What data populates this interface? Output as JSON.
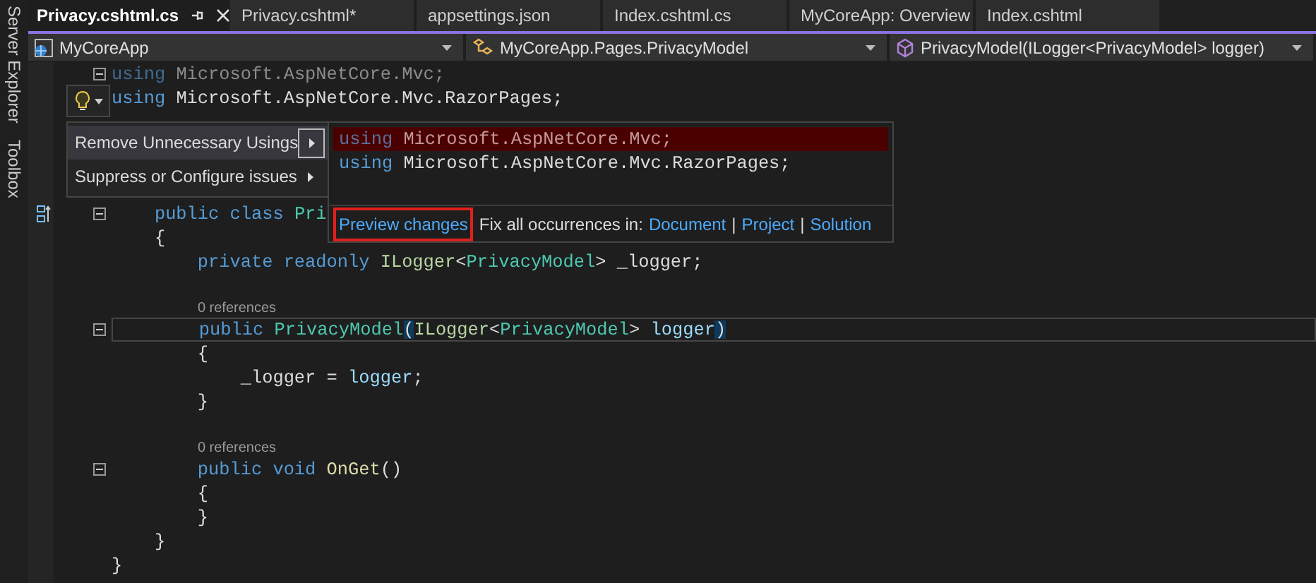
{
  "side_tabs": [
    {
      "label": "Server Explorer"
    },
    {
      "label": "Toolbox"
    }
  ],
  "tabs": [
    {
      "label": "Privacy.cshtml.cs",
      "selected": true
    },
    {
      "label": "Privacy.cshtml*",
      "selected": false
    },
    {
      "label": "appsettings.json",
      "selected": false
    },
    {
      "label": "Index.cshtml.cs",
      "selected": false
    },
    {
      "label": "MyCoreApp: Overview",
      "selected": false
    },
    {
      "label": "Index.cshtml",
      "selected": false
    }
  ],
  "nav": [
    {
      "kind": "project",
      "label": "MyCoreApp"
    },
    {
      "kind": "class",
      "label": "MyCoreApp.Pages.PrivacyModel"
    },
    {
      "kind": "method",
      "label": "PrivacyModel(ILogger<PrivacyModel> logger)"
    }
  ],
  "code_lines": [
    {
      "kind": "code",
      "fold": true,
      "tokens": [
        {
          "s": "using ",
          "color": "#3f6c94"
        },
        {
          "s": "Microsoft.AspNetCore.Mvc;",
          "color": "#8c8c8c"
        }
      ]
    },
    {
      "kind": "code",
      "fold": false,
      "tokens": [
        {
          "s": "using ",
          "color": "#569cd6"
        },
        {
          "s": "Microsoft.AspNetCore.Mvc.RazorPages;",
          "color": "#dcdcdc"
        }
      ]
    },
    {
      "kind": "blank"
    },
    {
      "kind": "blank"
    },
    {
      "kind": "blank"
    },
    {
      "kind": "lens"
    },
    {
      "kind": "code",
      "fold": true,
      "margin_icon": true,
      "tokens": [
        {
          "s": "    public class ",
          "color": "#569cd6"
        },
        {
          "s": "Pri",
          "color": "#4ec9b0"
        }
      ]
    },
    {
      "kind": "code",
      "fold": false,
      "tokens": [
        {
          "s": "    {",
          "color": "#dcdcdc"
        }
      ]
    },
    {
      "kind": "code",
      "fold": false,
      "tokens": [
        {
          "s": "        private readonly ",
          "color": "#569cd6"
        },
        {
          "s": "ILogger",
          "color": "#b8d7a3"
        },
        {
          "s": "<",
          "color": "#dcdcdc"
        },
        {
          "s": "PrivacyModel",
          "color": "#4ec9b0"
        },
        {
          "s": "> _logger;",
          "color": "#dcdcdc"
        }
      ]
    },
    {
      "kind": "blank"
    },
    {
      "kind": "lens",
      "text": "        0 references"
    },
    {
      "kind": "code",
      "fold": true,
      "current": true,
      "tokens": [
        {
          "s": "        public ",
          "color": "#569cd6"
        },
        {
          "s": "PrivacyModel",
          "color": "#4ec9b0"
        },
        {
          "s": "(",
          "match": true
        },
        {
          "s": "ILogger",
          "color": "#b8d7a3"
        },
        {
          "s": "<",
          "color": "#dcdcdc"
        },
        {
          "s": "PrivacyModel",
          "color": "#4ec9b0"
        },
        {
          "s": "> ",
          "color": "#dcdcdc"
        },
        {
          "s": "logger",
          "color": "#9cdcfe"
        },
        {
          "s": ")",
          "match": true
        }
      ]
    },
    {
      "kind": "code",
      "fold": false,
      "tokens": [
        {
          "s": "        {",
          "color": "#dcdcdc"
        }
      ]
    },
    {
      "kind": "code",
      "fold": false,
      "tokens": [
        {
          "s": "            _logger = ",
          "color": "#dcdcdc"
        },
        {
          "s": "logger",
          "color": "#9cdcfe"
        },
        {
          "s": ";",
          "color": "#dcdcdc"
        }
      ]
    },
    {
      "kind": "code",
      "fold": false,
      "tokens": [
        {
          "s": "        }",
          "color": "#dcdcdc"
        }
      ]
    },
    {
      "kind": "blank"
    },
    {
      "kind": "lens",
      "text": "        0 references"
    },
    {
      "kind": "code",
      "fold": true,
      "tokens": [
        {
          "s": "        public void ",
          "color": "#569cd6"
        },
        {
          "s": "OnGet",
          "color": "#dcdcaa"
        },
        {
          "s": "()",
          "color": "#dcdcdc"
        }
      ]
    },
    {
      "kind": "code",
      "fold": false,
      "tokens": [
        {
          "s": "        {",
          "color": "#dcdcdc"
        }
      ]
    },
    {
      "kind": "code",
      "fold": false,
      "tokens": [
        {
          "s": "        }",
          "color": "#dcdcdc"
        }
      ]
    },
    {
      "kind": "code",
      "fold": false,
      "tokens": [
        {
          "s": "    }",
          "color": "#dcdcdc"
        }
      ]
    },
    {
      "kind": "code",
      "fold": false,
      "tokens": [
        {
          "s": "}",
          "color": "#dcdcdc"
        }
      ]
    }
  ],
  "quick_actions": {
    "menu": [
      {
        "label": "Remove Unnecessary Usings",
        "selected": true
      },
      {
        "label": "Suppress or Configure issues",
        "selected": false
      }
    ],
    "preview": {
      "lines": [
        {
          "removed": true,
          "tokens": [
            {
              "s": "using ",
              "color": "#5a6f9c"
            },
            {
              "s": "Microsoft.AspNetCore.Mvc;",
              "color": "#c49a9a"
            }
          ]
        },
        {
          "removed": false,
          "tokens": [
            {
              "s": "using ",
              "color": "#569cd6"
            },
            {
              "s": "Microsoft.AspNetCore.Mvc.RazorPages;",
              "color": "#dcdcdc"
            }
          ]
        }
      ],
      "link": "Preview changes",
      "fix_label": "Fix all occurrences in:",
      "fix_items": [
        {
          "kind": "link",
          "label": "Document"
        },
        {
          "kind": "sep",
          "label": "|"
        },
        {
          "kind": "link",
          "label": "Project"
        },
        {
          "kind": "sep",
          "label": "|"
        },
        {
          "kind": "link",
          "label": "Solution"
        }
      ]
    }
  }
}
